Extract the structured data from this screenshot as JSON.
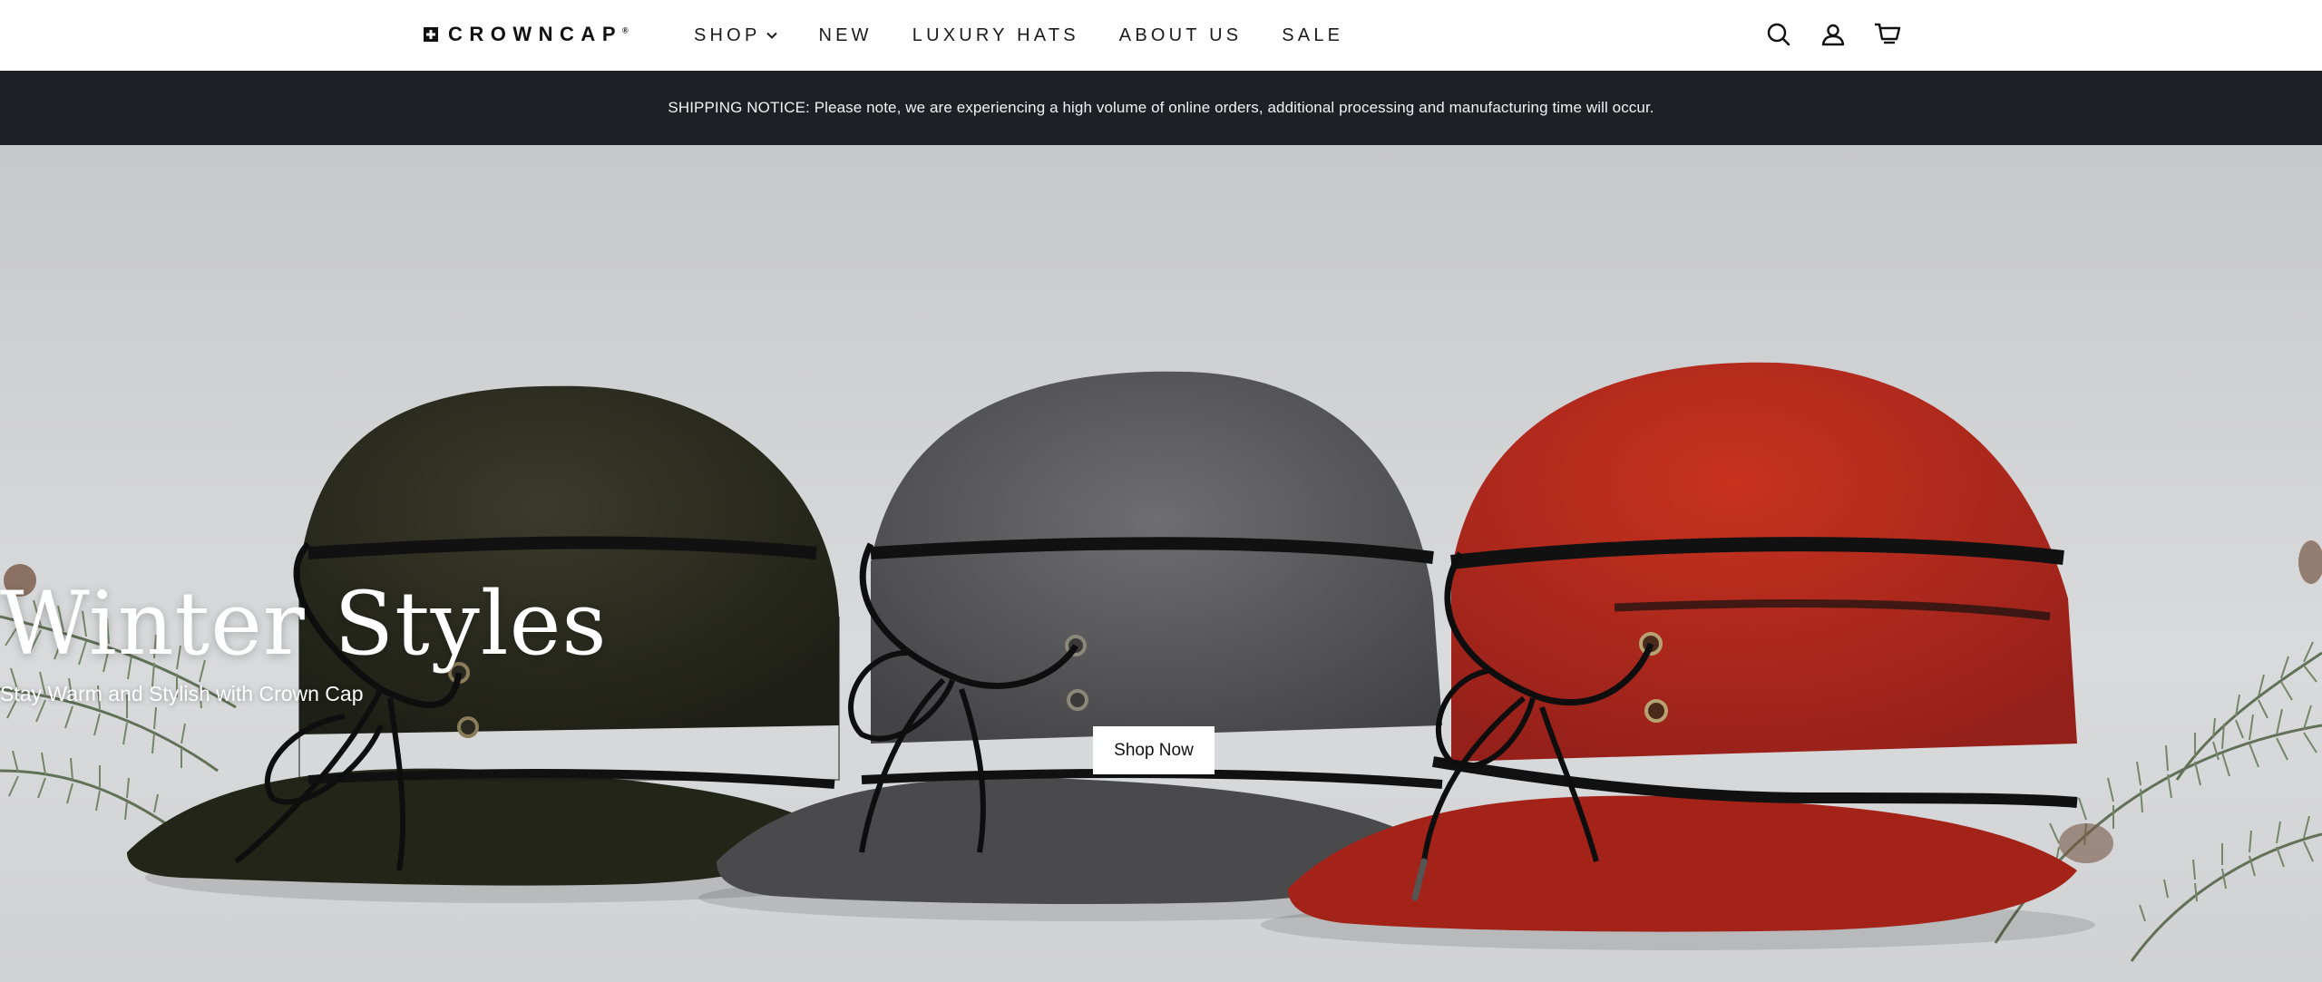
{
  "header": {
    "logo_text": "CROWNCAP",
    "logo_reg": "®",
    "nav": [
      {
        "label": "SHOP",
        "has_dropdown": true
      },
      {
        "label": "NEW"
      },
      {
        "label": "LUXURY HATS"
      },
      {
        "label": "ABOUT US"
      },
      {
        "label": "SALE"
      }
    ],
    "icons": [
      "search-icon",
      "account-icon",
      "cart-icon"
    ]
  },
  "notice": {
    "text": "SHIPPING NOTICE: Please note, we are experiencing a high volume of online orders, additional processing and manufacturing time will occur."
  },
  "hero": {
    "title": "Winter Styles",
    "subtitle": "Stay Warm and Stylish with Crown Cap",
    "button_label": "Shop Now",
    "colors": {
      "hat_left": "#2a2b1e",
      "hat_middle": "#5a5a5c",
      "hat_right": "#b3271d",
      "background": "#d2d3d5",
      "notice_bar": "#1f2025"
    }
  }
}
